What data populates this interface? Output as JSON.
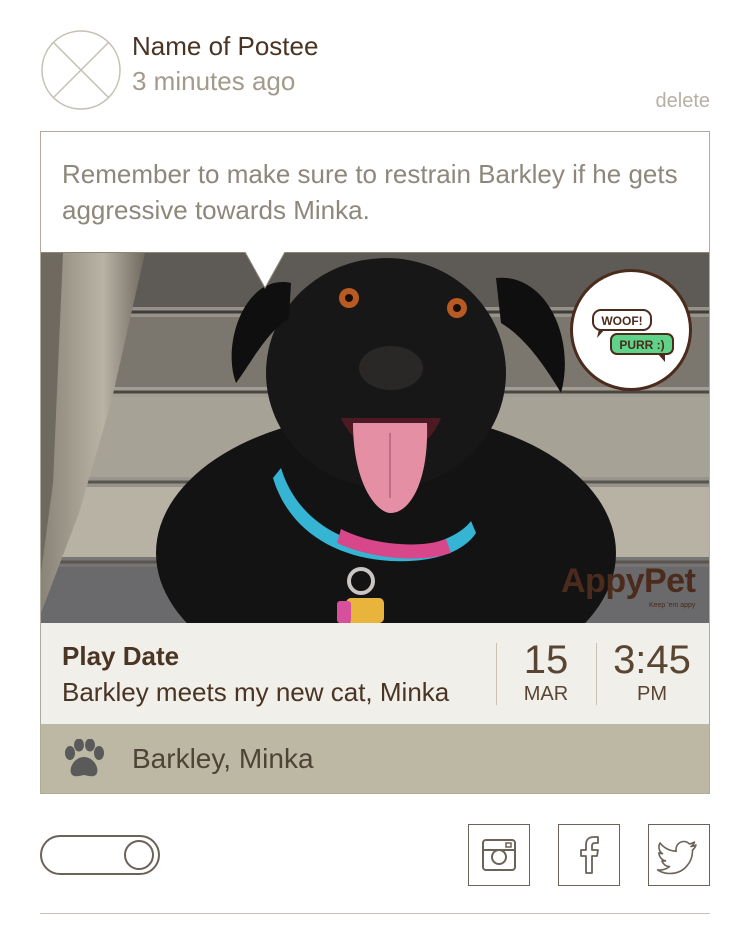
{
  "post": {
    "poster_name": "Name of Postee",
    "time_ago": "3 minutes ago",
    "delete_label": "delete",
    "note": "Remember to make sure to restrain Barkley if he gets aggressive towards Minka."
  },
  "photo": {
    "badge": {
      "top_text": "WOOF!",
      "bottom_text": "PURR :)"
    },
    "logo": {
      "name": "AppyPet",
      "tagline": "Keep 'em appy"
    }
  },
  "event": {
    "title": "Play Date",
    "description": "Barkley meets my new cat, Minka",
    "day": "15",
    "month": "MAR",
    "time": "3:45",
    "meridiem": "PM"
  },
  "pets": {
    "icon": "paw-icon",
    "names": "Barkley, Minka"
  },
  "footer": {
    "toggle_state": "on",
    "share_icons": [
      "instagram-icon",
      "facebook-icon",
      "twitter-icon"
    ]
  },
  "colors": {
    "brown_text": "#4a3423",
    "muted_text": "#8e877b",
    "event_bg": "#f1efe9",
    "pets_bar_bg": "#bdb8a4",
    "badge_green": "#5fd38a"
  }
}
